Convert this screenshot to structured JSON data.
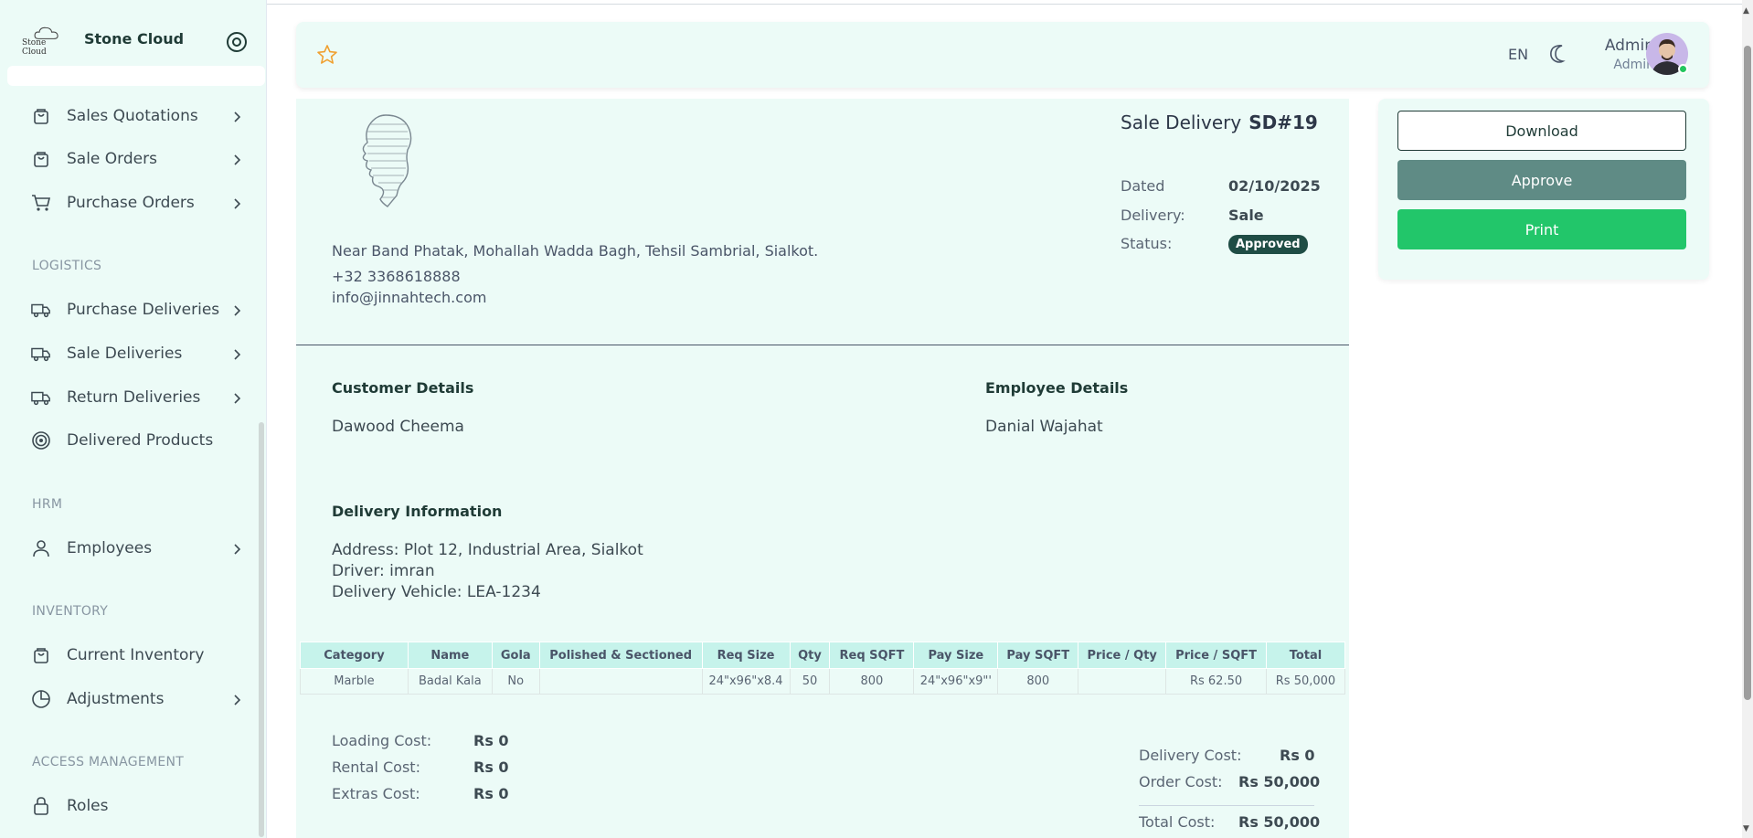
{
  "brand": {
    "logo_text": "Stone Cloud",
    "name": "Stone Cloud"
  },
  "sidebar": {
    "items": [
      {
        "label": "Sales Quotations",
        "icon": "bag-icon"
      },
      {
        "label": "Sale Orders",
        "icon": "bag-icon"
      },
      {
        "label": "Purchase Orders",
        "icon": "cart-icon"
      },
      {
        "label": "Purchase Deliveries",
        "icon": "truck-icon"
      },
      {
        "label": "Sale Deliveries",
        "icon": "truck-icon"
      },
      {
        "label": "Return Deliveries",
        "icon": "truck-icon"
      },
      {
        "label": "Delivered Products",
        "icon": "target-icon"
      },
      {
        "label": "Employees",
        "icon": "user-icon"
      },
      {
        "label": "Current Inventory",
        "icon": "bag-icon"
      },
      {
        "label": "Adjustments",
        "icon": "pie-icon"
      },
      {
        "label": "Roles",
        "icon": "lock-icon"
      }
    ],
    "sections": {
      "logistics": "LOGISTICS",
      "hrm": "HRM",
      "inventory": "INVENTORY",
      "access": "ACCESS MANAGEMENT"
    }
  },
  "header": {
    "lang": "EN",
    "user_name": "Admin",
    "user_role": "Admin"
  },
  "document": {
    "title": "Sale Delivery",
    "number": "SD#19",
    "address": "Near Band Phatak, Mohallah Wadda Bagh, Tehsil Sambrial, Sialkot.",
    "phone": "+32 3368618888",
    "email": "info@jinnahtech.com",
    "dated_label": "Dated",
    "dated": "02/10/2025",
    "delivery_label": "Delivery:",
    "delivery": "Sale",
    "status_label": "Status:",
    "status": "Approved",
    "customer_heading": "Customer Details",
    "customer": "Dawood Cheema",
    "employee_heading": "Employee Details",
    "employee": "Danial Wajahat",
    "delivery_heading": "Delivery Information",
    "delivery_address": "Address: Plot 12, Industrial Area, Sialkot",
    "driver": "Driver: imran",
    "vehicle": "Delivery Vehicle: LEA-1234"
  },
  "table": {
    "headers": [
      "Category",
      "Name",
      "Gola",
      "Polished & Sectioned",
      "Req Size",
      "Qty",
      "Req SQFT",
      "Pay Size",
      "Pay SQFT",
      "Price / Qty",
      "Price / SQFT",
      "Total"
    ],
    "rows": [
      [
        "Marble",
        "Badal Kala",
        "No",
        "",
        "24\"x96\"x8.4",
        "50",
        "800",
        "24\"x96\"x9\"'",
        "800",
        "",
        "Rs 62.50",
        "Rs 50,000"
      ]
    ]
  },
  "costs": {
    "loading_label": "Loading Cost:",
    "loading": "Rs 0",
    "rental_label": "Rental Cost:",
    "rental": "Rs 0",
    "extras_label": "Extras Cost:",
    "extras": "Rs 0",
    "delivery_label": "Delivery Cost:",
    "delivery": "Rs 0",
    "order_label": "Order Cost:",
    "order": "Rs 50,000",
    "total_label": "Total Cost:",
    "total": "Rs 50,000"
  },
  "actions": {
    "download": "Download",
    "approve": "Approve",
    "print": "Print"
  },
  "colors": {
    "accent": "#1f4d45",
    "approve": "#5f8b85",
    "print": "#22c66a",
    "panel": "#ecfbf7",
    "table_head": "#c6f3eb"
  }
}
